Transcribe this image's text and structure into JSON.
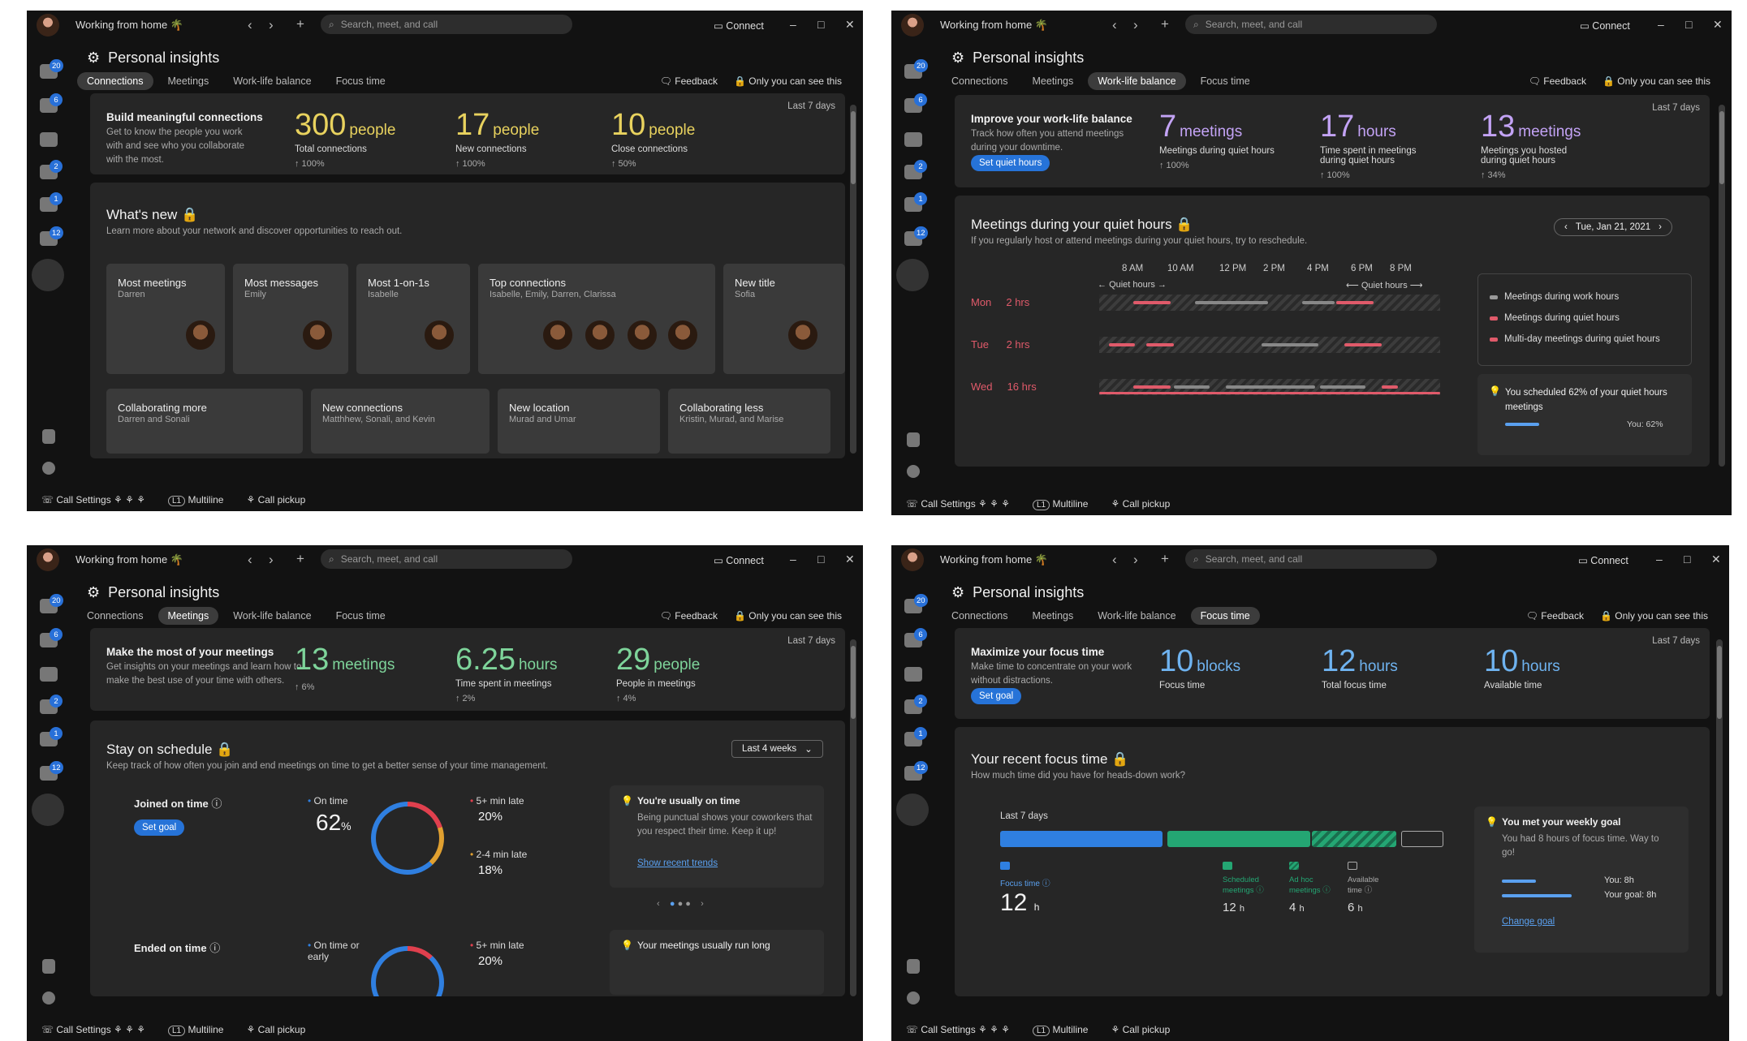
{
  "app": {
    "window_title": "Working from home 🌴",
    "search_placeholder": "Search, meet, and call",
    "connect": "Connect",
    "page_title": "Personal insights",
    "tabs": [
      "Connections",
      "Meetings",
      "Work-life balance",
      "Focus time"
    ],
    "feedback": "Feedback",
    "privacy": "Only you can see this",
    "last7": "Last 7 days",
    "rail_badges": [
      "20",
      "6",
      "2",
      "1",
      "12"
    ],
    "bottom": {
      "call_settings": "Call Settings",
      "multiline": "Multiline",
      "multiline_tag": "L1",
      "call_pickup": "Call pickup"
    }
  },
  "connections": {
    "head": "Build meaningful connections",
    "desc": "Get to know the people you work with and see who you collaborate with the most.",
    "metrics": [
      {
        "value": "300",
        "unit": "people",
        "label": "Total connections",
        "trend": "↑ 100%"
      },
      {
        "value": "17",
        "unit": "people",
        "label": "New connections",
        "trend": "↑ 100%"
      },
      {
        "value": "10",
        "unit": "people",
        "label": "Close connections",
        "trend": "↑ 50%"
      }
    ],
    "whats_new_title": "What's new",
    "whats_new_desc": "Learn more about your network and discover opportunities to reach out.",
    "cards": [
      {
        "title": "Most meetings",
        "sub": "Darren"
      },
      {
        "title": "Most messages",
        "sub": "Emily"
      },
      {
        "title": "Most 1-on-1s",
        "sub": "Isabelle"
      },
      {
        "title": "Top connections",
        "sub": "Isabelle, Emily, Darren, Clarissa"
      },
      {
        "title": "New title",
        "sub": "Sofia"
      }
    ],
    "cards2": [
      {
        "title": "Collaborating more",
        "sub": "Darren and Sonali"
      },
      {
        "title": "New connections",
        "sub": "Matthhew, Sonali, and Kevin"
      },
      {
        "title": "New location",
        "sub": "Murad and Umar"
      },
      {
        "title": "Collaborating less",
        "sub": "Kristin, Murad, and Marise"
      }
    ]
  },
  "worklife": {
    "head": "Improve your work-life balance",
    "desc": "Track how often you attend meetings during your downtime.",
    "button": "Set quiet hours",
    "metrics": [
      {
        "value": "7",
        "unit": "meetings",
        "label": "Meetings during quiet hours",
        "trend": "↑ 100%"
      },
      {
        "value": "17",
        "unit": "hours",
        "label": "Time spent in meetings during quiet hours",
        "trend": "↑ 100%"
      },
      {
        "value": "13",
        "unit": "meetings",
        "label": "Meetings you hosted during quiet hours",
        "trend": "↑ 34%"
      }
    ],
    "section_title": "Meetings during your quiet hours",
    "section_desc": "If you regularly host or attend meetings during your quiet hours, try to reschedule.",
    "date": "Tue, Jan 21, 2021",
    "times": [
      "8 AM",
      "10 AM",
      "12 PM",
      "2 PM",
      "4 PM",
      "6 PM",
      "8 PM"
    ],
    "quiet_label": "Quiet hours",
    "rows": [
      {
        "day": "Mon",
        "hrs": "2 hrs"
      },
      {
        "day": "Tue",
        "hrs": "2 hrs"
      },
      {
        "day": "Wed",
        "hrs": "16 hrs"
      }
    ],
    "legend": [
      "Meetings during work hours",
      "Meetings during quiet hours",
      "Multi-day meetings during quiet hours"
    ],
    "tip": "You scheduled 62% of your quiet hours meetings",
    "tip_you": "You: 62%"
  },
  "meetings": {
    "head": "Make the most of your meetings",
    "desc": "Get insights on your meetings and learn how to make the best use of your time with others.",
    "metrics": [
      {
        "value": "13",
        "unit": "meetings",
        "label": "",
        "trend": "↑ 6%"
      },
      {
        "value": "6.25",
        "unit": "hours",
        "label": "Time spent in meetings",
        "trend": "↑ 2%"
      },
      {
        "value": "29",
        "unit": "people",
        "label": "People in meetings",
        "trend": "↑ 4%"
      }
    ],
    "section_title": "Stay on schedule",
    "section_desc": "Keep track of how often you join and end meetings on time to get a better sense of your time management.",
    "range": "Last 4 weeks",
    "joined": "Joined on time",
    "set_goal": "Set goal",
    "on_time": "On time",
    "on_time_val": "62",
    "pct": "%",
    "late5": "5+ min late",
    "late5_val": "20%",
    "late2": "2-4 min late",
    "late2_val": "18%",
    "ended": "Ended on time",
    "on_time_early": "On time or early",
    "late5_val2": "20%",
    "tip_title": "You're usually on time",
    "tip_desc": "Being punctual shows your coworkers that you respect their time. Keep it up!",
    "tip_link": "Show recent trends",
    "tip2_title": "Your meetings usually run long",
    "donut": {
      "on_time": 62,
      "late5": 20,
      "late2": 18
    }
  },
  "focus": {
    "head": "Maximize your focus time",
    "desc": "Make time to concentrate on your work without distractions.",
    "button": "Set goal",
    "metrics": [
      {
        "value": "10",
        "unit": "blocks",
        "label": "Focus time"
      },
      {
        "value": "12",
        "unit": "hours",
        "label": "Total focus time"
      },
      {
        "value": "10",
        "unit": "hours",
        "label": "Available time"
      }
    ],
    "section_title": "Your recent focus time",
    "section_desc": "How much time did you have for heads-down work?",
    "bar_label": "Last 7 days",
    "cats": [
      {
        "name": "Focus time",
        "val": "12",
        "unit": "h"
      },
      {
        "name": "Scheduled meetings",
        "val": "12",
        "unit": "h"
      },
      {
        "name": "Ad hoc meetings",
        "val": "4",
        "unit": "h"
      },
      {
        "name": "Available time",
        "val": "6",
        "unit": "h"
      }
    ],
    "tip_title": "You met your weekly goal",
    "tip_desc": "You had 8 hours of focus time. Way to go!",
    "you": "You: 8h",
    "goal": "Your goal: 8h",
    "link": "Change goal",
    "colors": {
      "focus": "#2f7fe0",
      "scheduled": "#24a673",
      "adhoc": "#24a673"
    }
  }
}
